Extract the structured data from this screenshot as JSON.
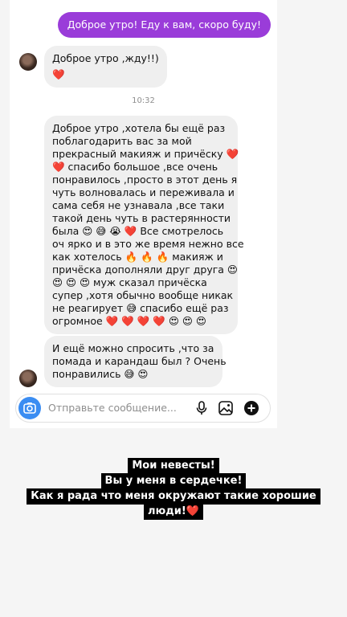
{
  "chat": {
    "outgoing_message": "Доброе утро! Еду к вам, скоро буду!",
    "reply_1": {
      "text": "Доброе утро ,жду!!)",
      "emoji": "❤️"
    },
    "timestamp": "10:32",
    "message_2_lines": [
      "Доброе утро ,хотела бы ещё раз",
      "поблагодарить вас за мой",
      "прекрасный макияж и причёску ❤️",
      "❤️ спасибо большое ,все очень",
      "понравилось ,просто в этот день я",
      "чуть волновалась и переживала и",
      "сама себя не узнавала ,все таки",
      "такой день чуть в растерянности",
      "была 😍 😅 😭 ❤️ Все смотрелось",
      "оч ярко и в это же время нежно все",
      "как хотелось 🔥 🔥 🔥 макияж и",
      "причёска дополняли друг друга 😍",
      "😍 😍 😍 муж сказал причёска",
      "супер ,хотя обычно вообще никак",
      "не реагирует 😅 спасибо ещё раз",
      "огромное ❤️ ❤️ ❤️ ❤️ 😍 😍 😍"
    ],
    "message_3_lines": [
      "И ещё можно спросить ,что за",
      "помада и карандаш был ? Очень",
      "понравились 😅 😍"
    ]
  },
  "composer": {
    "placeholder": "Отправьте сообщение..."
  },
  "story_caption": {
    "lines": [
      "Мои невесты!",
      "Вы у меня в сердечке!",
      "Как я рада что меня окружают такие хорошие",
      "люди!❤️"
    ]
  },
  "colors": {
    "outgoing_bubble": "#9a3cd9",
    "incoming_bubble": "#efefef",
    "camera_button": "#3b8df2",
    "caption_bg": "#000000"
  },
  "icons": [
    "camera-icon",
    "microphone-icon",
    "gallery-icon",
    "add-icon"
  ]
}
